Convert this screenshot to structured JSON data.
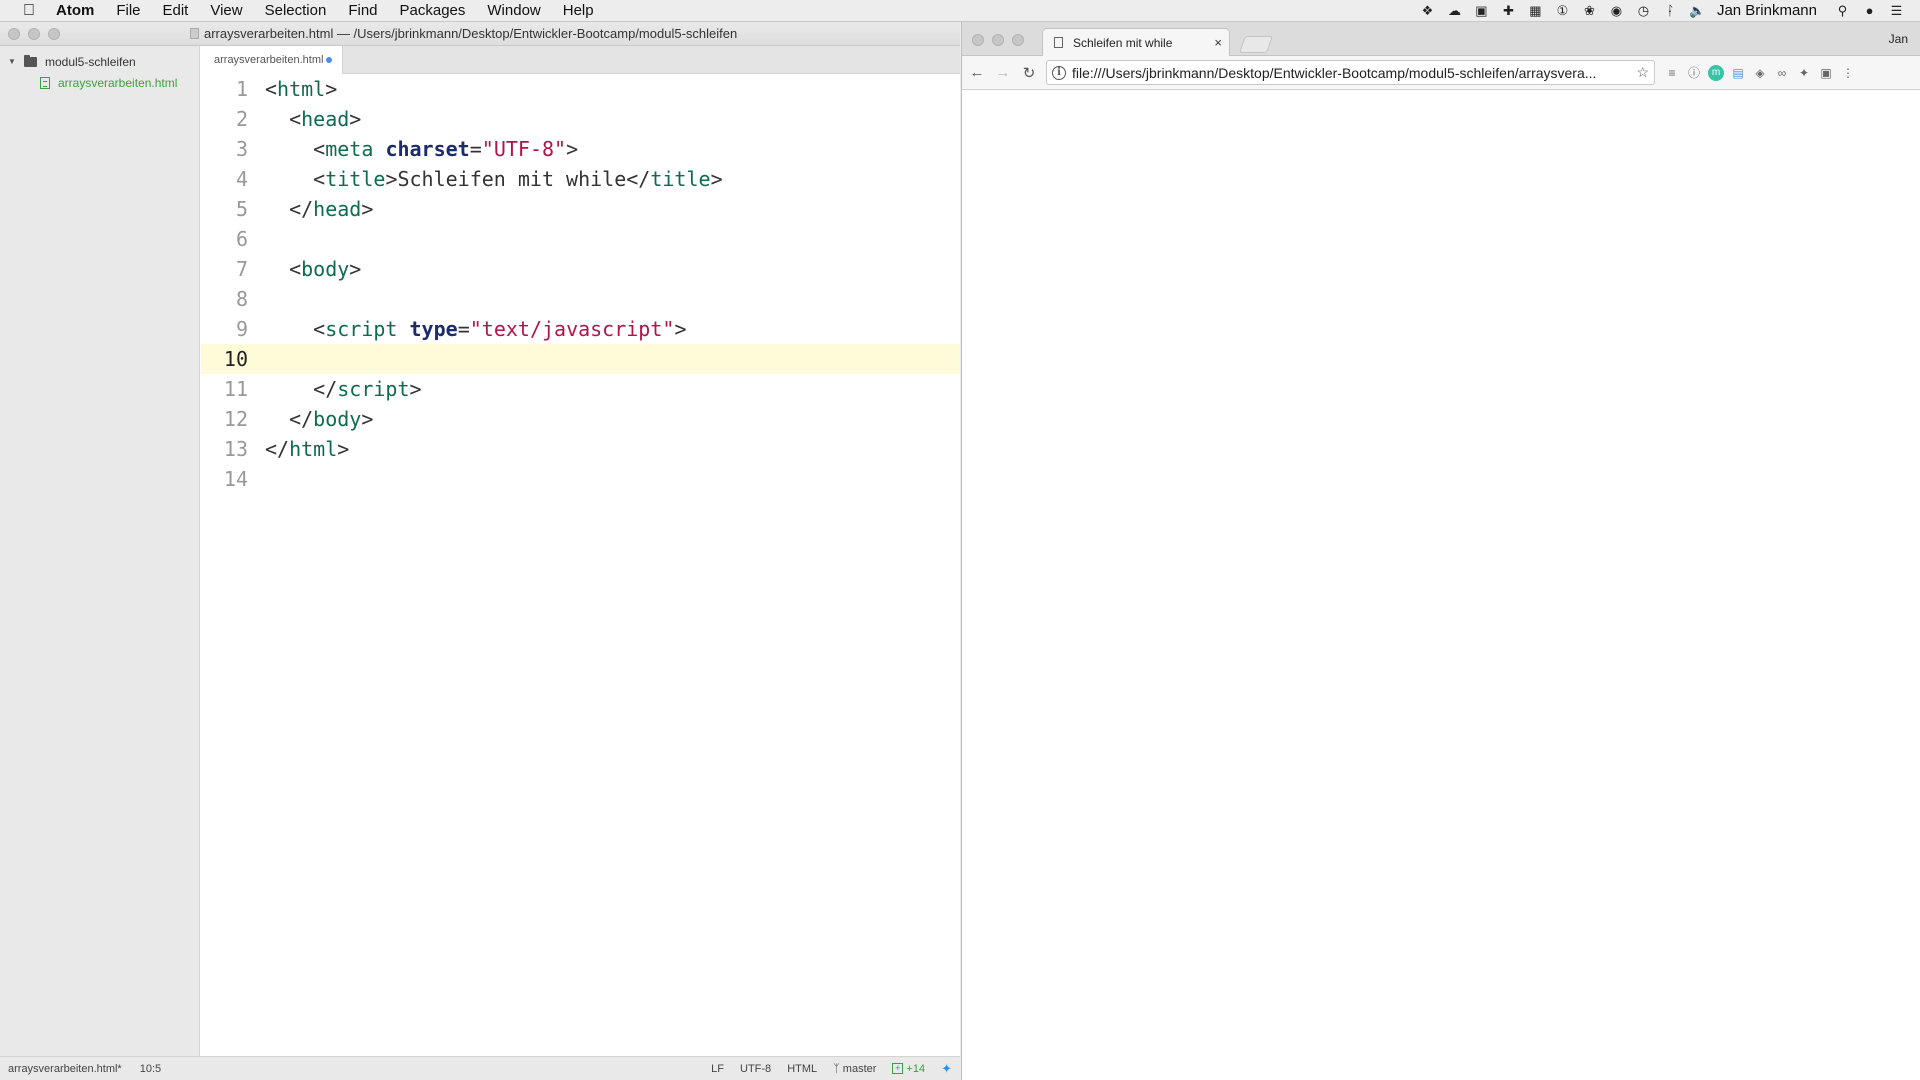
{
  "menubar": {
    "app_name": "Atom",
    "menus": [
      "File",
      "Edit",
      "View",
      "Selection",
      "Find",
      "Packages",
      "Window",
      "Help"
    ],
    "tray_icons": [
      "dropbox-icon",
      "cloud-icon",
      "camera-icon",
      "plus-cross-icon",
      "calendar-icon",
      "onepassword-icon",
      "leaf-icon",
      "alfred-icon",
      "time-machine-icon",
      "bluetooth-icon",
      "volume-icon"
    ],
    "user_name": "Jan Brinkmann"
  },
  "atom": {
    "window_title": "arraysverarbeiten.html — /Users/jbrinkmann/Desktop/Entwickler-Bootcamp/modul5-schleifen",
    "tree": {
      "root_folder": "modul5-schleifen",
      "files": [
        "arraysverarbeiten.html"
      ]
    },
    "tab": {
      "title": "arraysverarbeiten.html",
      "modified": true
    },
    "editor": {
      "current_line": 10,
      "lines": [
        {
          "num": "1",
          "tokens": [
            [
              "pun",
              "<"
            ],
            [
              "tag",
              "html"
            ],
            [
              "pun",
              ">"
            ]
          ]
        },
        {
          "num": "2",
          "tokens": [
            [
              "pun",
              "  <"
            ],
            [
              "tag",
              "head"
            ],
            [
              "pun",
              ">"
            ]
          ]
        },
        {
          "num": "3",
          "tokens": [
            [
              "pun",
              "    <"
            ],
            [
              "tag",
              "meta"
            ],
            [
              "pun",
              " "
            ],
            [
              "attr",
              "charset"
            ],
            [
              "pun",
              "="
            ],
            [
              "str",
              "\"UTF-8\""
            ],
            [
              "pun",
              ">"
            ]
          ]
        },
        {
          "num": "4",
          "tokens": [
            [
              "pun",
              "    <"
            ],
            [
              "tag",
              "title"
            ],
            [
              "pun",
              ">Schleifen mit while</"
            ],
            [
              "tag",
              "title"
            ],
            [
              "pun",
              ">"
            ]
          ]
        },
        {
          "num": "5",
          "tokens": [
            [
              "pun",
              "  </"
            ],
            [
              "tag",
              "head"
            ],
            [
              "pun",
              ">"
            ]
          ]
        },
        {
          "num": "6",
          "tokens": []
        },
        {
          "num": "7",
          "tokens": [
            [
              "pun",
              "  <"
            ],
            [
              "tag",
              "body"
            ],
            [
              "pun",
              ">"
            ]
          ]
        },
        {
          "num": "8",
          "tokens": []
        },
        {
          "num": "9",
          "tokens": [
            [
              "pun",
              "    <"
            ],
            [
              "tag",
              "script"
            ],
            [
              "pun",
              " "
            ],
            [
              "attr",
              "type"
            ],
            [
              "pun",
              "="
            ],
            [
              "str",
              "\"text/javascript\""
            ],
            [
              "pun",
              ">"
            ]
          ]
        },
        {
          "num": "10",
          "tokens": []
        },
        {
          "num": "11",
          "tokens": [
            [
              "pun",
              "    </"
            ],
            [
              "tag",
              "script"
            ],
            [
              "pun",
              ">"
            ]
          ]
        },
        {
          "num": "12",
          "tokens": [
            [
              "pun",
              "  </"
            ],
            [
              "tag",
              "body"
            ],
            [
              "pun",
              ">"
            ]
          ]
        },
        {
          "num": "13",
          "tokens": [
            [
              "pun",
              "</"
            ],
            [
              "tag",
              "html"
            ],
            [
              "pun",
              ">"
            ]
          ]
        },
        {
          "num": "14",
          "tokens": []
        }
      ]
    },
    "status": {
      "file": "arraysverarbeiten.html*",
      "cursor": "10:5",
      "line_ending": "LF",
      "encoding": "UTF-8",
      "grammar": "HTML",
      "branch": "master",
      "git_added": "+14"
    }
  },
  "chrome": {
    "tab_title": "Schleifen mit while",
    "tab_close": "×",
    "profile_name": "Jan",
    "url": "file:///Users/jbrinkmann/Desktop/Entwickler-Bootcamp/modul5-schleifen/arraysvera...",
    "extensions": [
      "buffer-icon",
      "info-circle-icon",
      "m-extension-icon",
      "reader-icon",
      "evernote-icon",
      "link-icon",
      "bird-icon",
      "camera-icon",
      "menu-dots-icon"
    ]
  },
  "colors": {
    "tag": "#0d6b4f",
    "attribute": "#1b2c6b",
    "string": "#b0154a",
    "current_line": "#fdfbd8",
    "git_green": "#3aa140",
    "modified_dot": "#4f8ee8"
  }
}
